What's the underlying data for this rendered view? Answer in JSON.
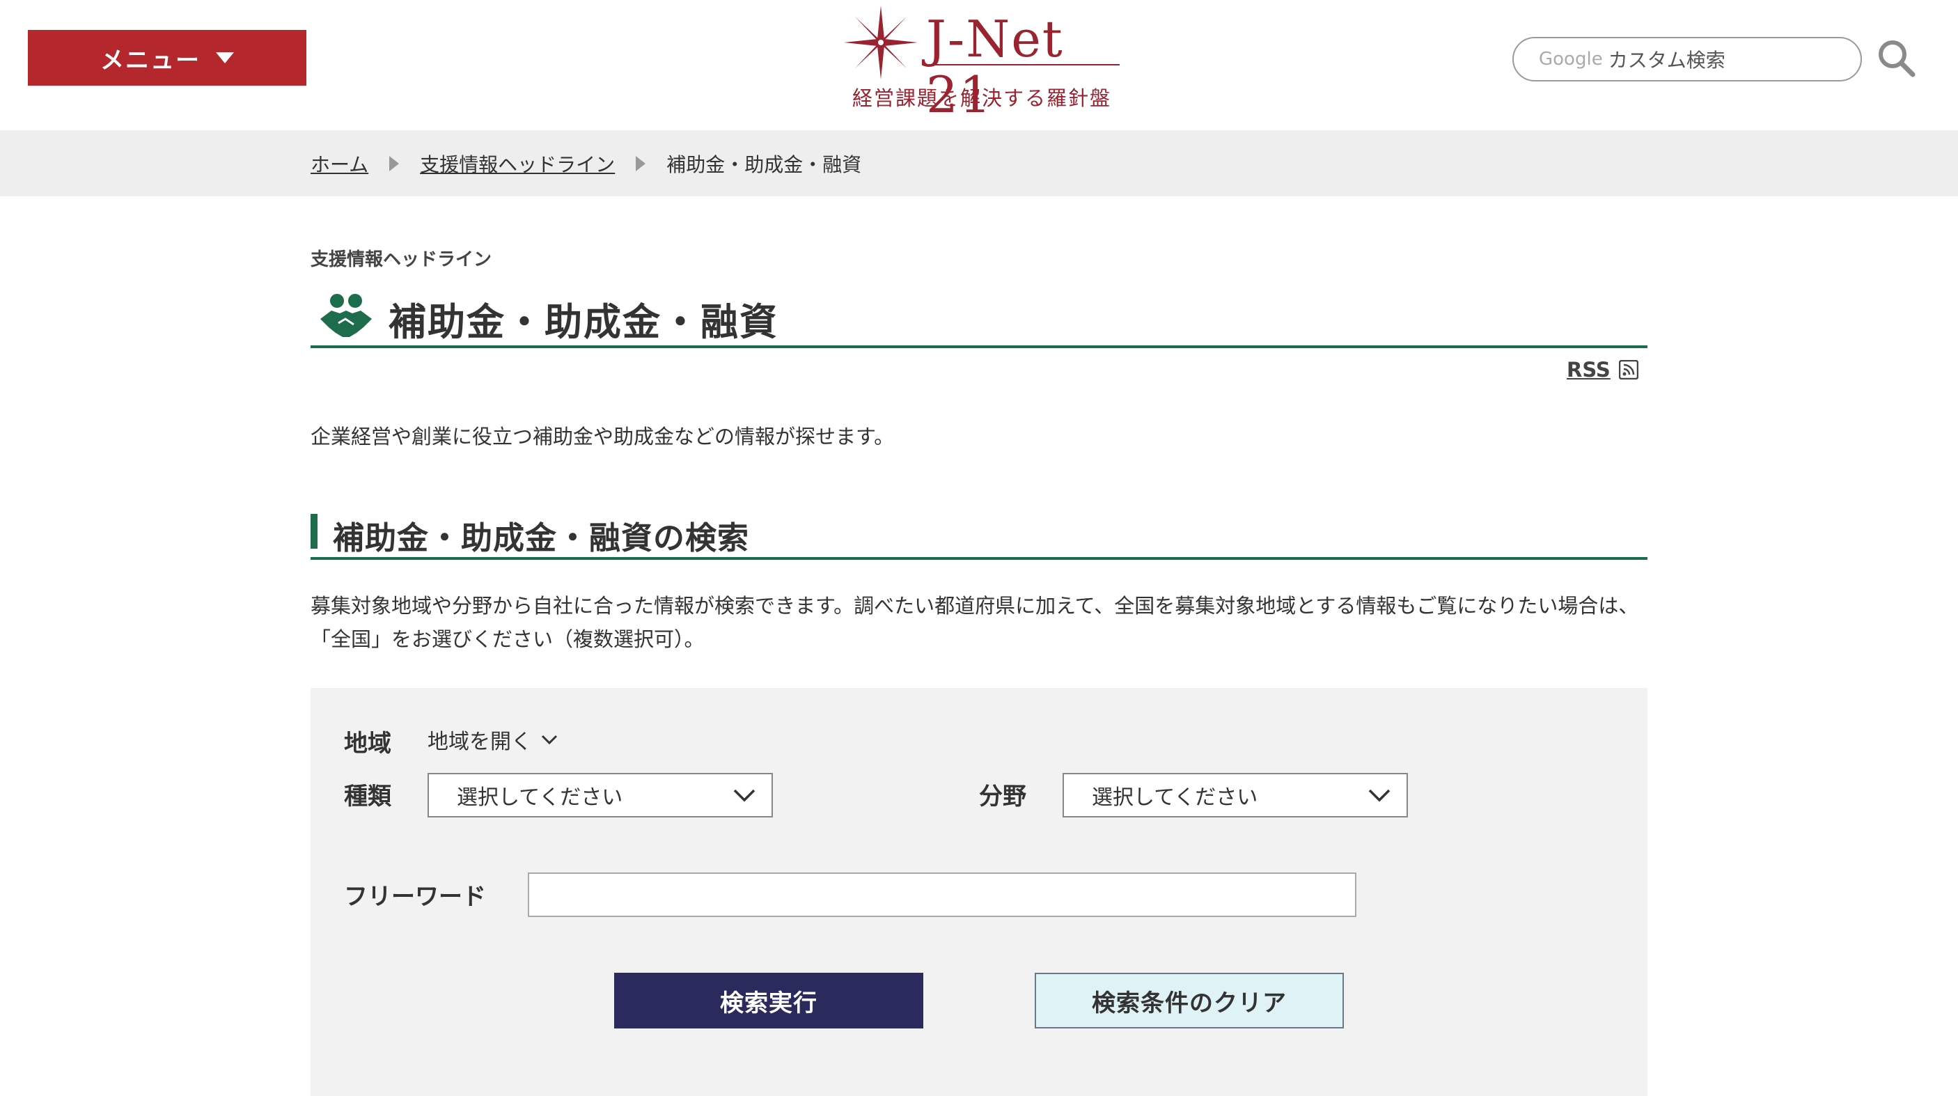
{
  "header": {
    "menu_label": "メニュー",
    "logo_name": "J-Net 21",
    "logo_tagline": "経営課題を解決する羅針盤",
    "search_google": "Google",
    "search_placeholder": "カスタム検索",
    "brand_color": "#b3272d"
  },
  "breadcrumb": {
    "items": [
      "ホーム",
      "支援情報ヘッドライン",
      "補助金・助成金・融資"
    ]
  },
  "main": {
    "section_label": "支援情報ヘッドライン",
    "title": "補助金・助成金・融資",
    "title_icon": "handshake-icon",
    "rss_label": "RSS",
    "intro": "企業経営や創業に役立つ補助金や助成金などの情報が探せます。",
    "search_heading": "補助金・助成金・融資の検索",
    "search_description": "募集対象地域や分野から自社に合った情報が検索できます。調べたい都道府県に加えて、全国を募集対象地域とする情報もご覧になりたい場合は、「全国」をお選びください（複数選択可）。",
    "accent_color": "#1d6c4c"
  },
  "search_form": {
    "region_label": "地域",
    "region_toggle": "地域を開く",
    "type_label": "種類",
    "type_value": "選択してください",
    "field_label": "分野",
    "field_value": "選択してください",
    "freeword_label": "フリーワード",
    "freeword_value": "",
    "submit_label": "検索実行",
    "clear_label": "検索条件のクリア",
    "submit_color": "#2a2a5c",
    "clear_color": "#dff3f6"
  }
}
